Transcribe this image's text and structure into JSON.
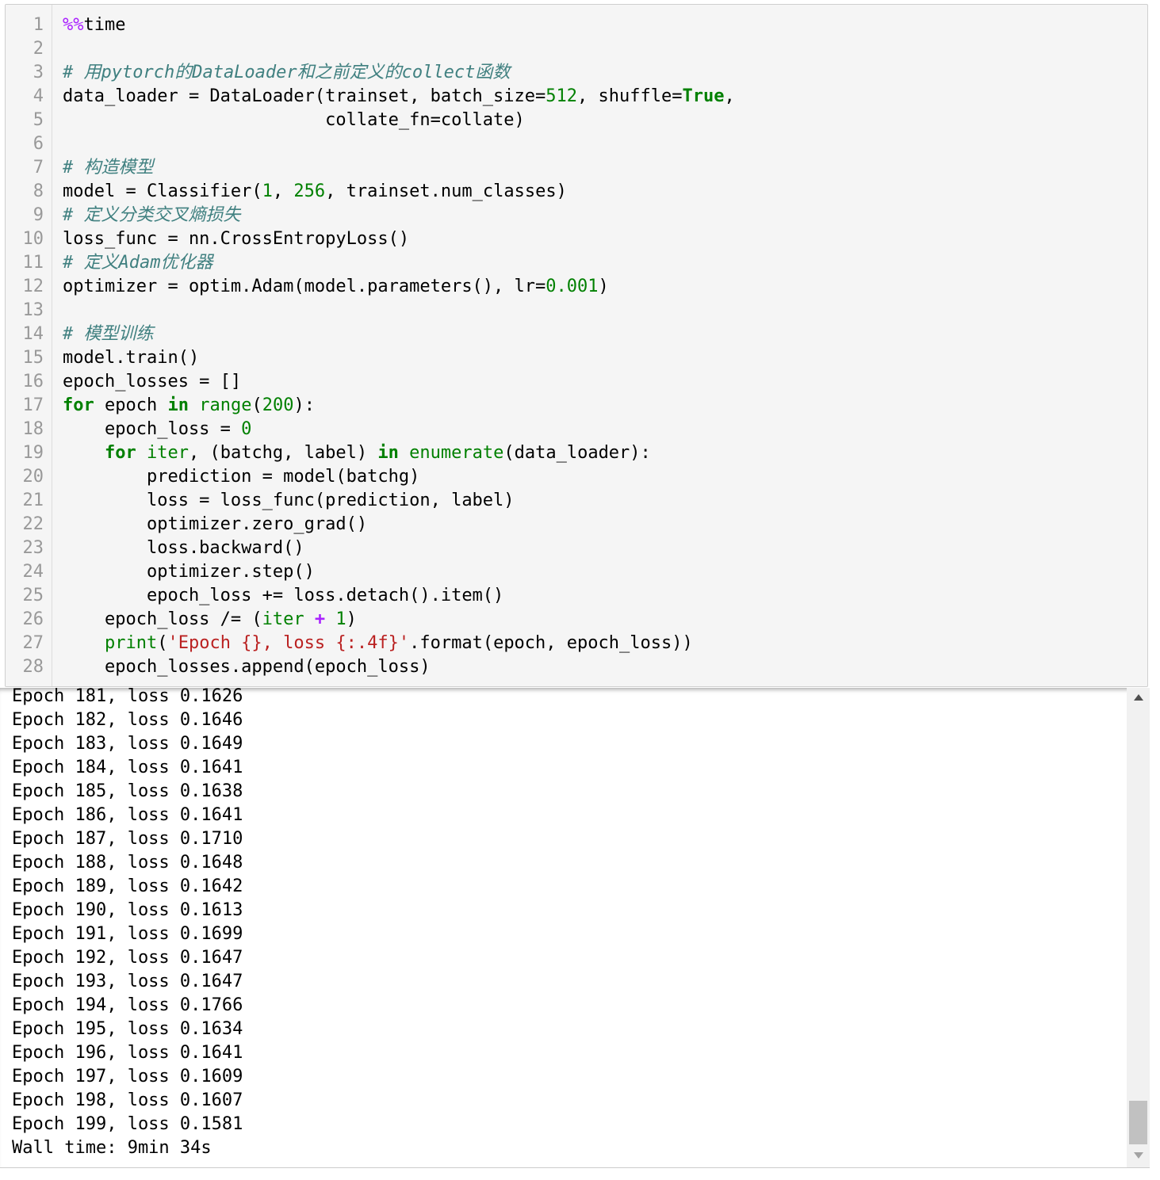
{
  "code_cell": {
    "line_numbers": [
      "1",
      "2",
      "3",
      "4",
      "5",
      "6",
      "7",
      "8",
      "9",
      "10",
      "11",
      "12",
      "13",
      "14",
      "15",
      "16",
      "17",
      "18",
      "19",
      "20",
      "21",
      "22",
      "23",
      "24",
      "25",
      "26",
      "27",
      "28"
    ],
    "lines": [
      [
        {
          "t": "%%",
          "c": "m"
        },
        {
          "t": "time",
          "c": ""
        }
      ],
      [],
      [
        {
          "t": "# 用pytorch的DataLoader和之前定义的collect函数",
          "c": "c"
        }
      ],
      [
        {
          "t": "data_loader = DataLoader(trainset, batch_size=",
          "c": ""
        },
        {
          "t": "512",
          "c": "n"
        },
        {
          "t": ", shuffle=",
          "c": ""
        },
        {
          "t": "True",
          "c": "k"
        },
        {
          "t": ",",
          "c": ""
        }
      ],
      [
        {
          "t": "                         collate_fn=collate)",
          "c": ""
        }
      ],
      [],
      [
        {
          "t": "# 构造模型",
          "c": "c"
        }
      ],
      [
        {
          "t": "model = Classifier(",
          "c": ""
        },
        {
          "t": "1",
          "c": "n"
        },
        {
          "t": ", ",
          "c": ""
        },
        {
          "t": "256",
          "c": "n"
        },
        {
          "t": ", trainset.num_classes)",
          "c": ""
        }
      ],
      [
        {
          "t": "# 定义分类交叉熵损失",
          "c": "c"
        }
      ],
      [
        {
          "t": "loss_func = nn.CrossEntropyLoss()",
          "c": ""
        }
      ],
      [
        {
          "t": "# 定义Adam优化器",
          "c": "c"
        }
      ],
      [
        {
          "t": "optimizer = optim.Adam(model.parameters(), lr=",
          "c": ""
        },
        {
          "t": "0.001",
          "c": "n"
        },
        {
          "t": ")",
          "c": ""
        }
      ],
      [],
      [
        {
          "t": "# 模型训练",
          "c": "c"
        }
      ],
      [
        {
          "t": "model.train()",
          "c": ""
        }
      ],
      [
        {
          "t": "epoch_losses = []",
          "c": ""
        }
      ],
      [
        {
          "t": "for",
          "c": "k"
        },
        {
          "t": " epoch ",
          "c": ""
        },
        {
          "t": "in",
          "c": "k"
        },
        {
          "t": " ",
          "c": ""
        },
        {
          "t": "range",
          "c": "b"
        },
        {
          "t": "(",
          "c": ""
        },
        {
          "t": "200",
          "c": "n"
        },
        {
          "t": "):",
          "c": ""
        }
      ],
      [
        {
          "t": "    epoch_loss = ",
          "c": ""
        },
        {
          "t": "0",
          "c": "n"
        }
      ],
      [
        {
          "t": "    ",
          "c": ""
        },
        {
          "t": "for",
          "c": "k"
        },
        {
          "t": " ",
          "c": ""
        },
        {
          "t": "iter",
          "c": "b"
        },
        {
          "t": ", (batchg, label) ",
          "c": ""
        },
        {
          "t": "in",
          "c": "k"
        },
        {
          "t": " ",
          "c": ""
        },
        {
          "t": "enumerate",
          "c": "b"
        },
        {
          "t": "(data_loader):",
          "c": ""
        }
      ],
      [
        {
          "t": "        prediction = model(batchg)",
          "c": ""
        }
      ],
      [
        {
          "t": "        loss = loss_func(prediction, label)",
          "c": ""
        }
      ],
      [
        {
          "t": "        optimizer.zero_grad()",
          "c": ""
        }
      ],
      [
        {
          "t": "        loss.backward()",
          "c": ""
        }
      ],
      [
        {
          "t": "        optimizer.step()",
          "c": ""
        }
      ],
      [
        {
          "t": "        epoch_loss += loss.detach().item()",
          "c": ""
        }
      ],
      [
        {
          "t": "    epoch_loss /= (",
          "c": ""
        },
        {
          "t": "iter",
          "c": "b"
        },
        {
          "t": " ",
          "c": ""
        },
        {
          "t": "+",
          "c": "o"
        },
        {
          "t": " ",
          "c": ""
        },
        {
          "t": "1",
          "c": "n"
        },
        {
          "t": ")",
          "c": ""
        }
      ],
      [
        {
          "t": "    ",
          "c": ""
        },
        {
          "t": "print",
          "c": "b"
        },
        {
          "t": "(",
          "c": ""
        },
        {
          "t": "'Epoch {}, loss {:.4f}'",
          "c": "s"
        },
        {
          "t": ".format(epoch, epoch_loss))",
          "c": ""
        }
      ],
      [
        {
          "t": "    epoch_losses.append(epoch_loss)",
          "c": ""
        }
      ]
    ]
  },
  "output": {
    "lines": [
      "Epoch 181, loss 0.1626",
      "Epoch 182, loss 0.1646",
      "Epoch 183, loss 0.1649",
      "Epoch 184, loss 0.1641",
      "Epoch 185, loss 0.1638",
      "Epoch 186, loss 0.1641",
      "Epoch 187, loss 0.1710",
      "Epoch 188, loss 0.1648",
      "Epoch 189, loss 0.1642",
      "Epoch 190, loss 0.1613",
      "Epoch 191, loss 0.1699",
      "Epoch 192, loss 0.1647",
      "Epoch 193, loss 0.1647",
      "Epoch 194, loss 0.1766",
      "Epoch 195, loss 0.1634",
      "Epoch 196, loss 0.1641",
      "Epoch 197, loss 0.1609",
      "Epoch 198, loss 0.1607",
      "Epoch 199, loss 0.1581",
      "Wall time: 9min 34s"
    ],
    "scroll_position": 0.95
  },
  "icons": {
    "scroll_up": "triangle-up-icon",
    "scroll_down": "triangle-down-icon"
  },
  "colors": {
    "keyword": "#008000",
    "string": "#ba2121",
    "comment": "#408080",
    "magic": "#aa22ff",
    "cell_background": "#f5f5f5"
  }
}
